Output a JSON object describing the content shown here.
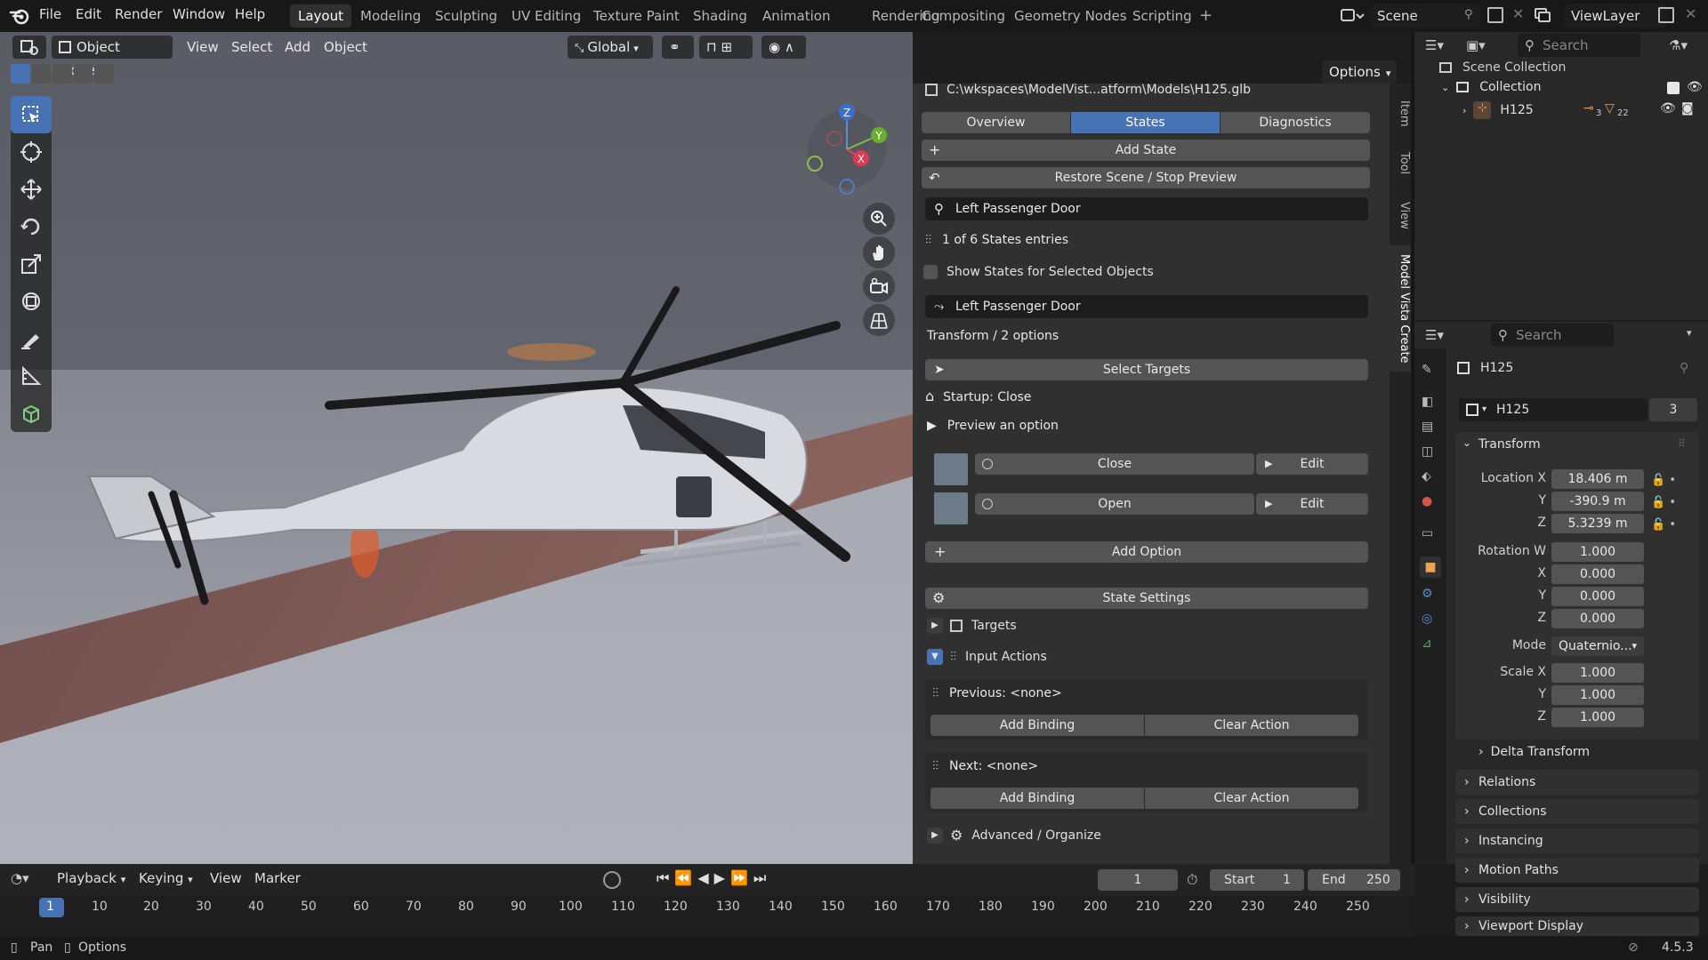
{
  "topbar": {
    "menus": [
      "File",
      "Edit",
      "Render",
      "Window",
      "Help"
    ],
    "workspaces": [
      "Layout",
      "Modeling",
      "Sculpting",
      "UV Editing",
      "Texture Paint",
      "Shading",
      "Animation",
      "Rendering",
      "Compositing",
      "Geometry Nodes",
      "Scripting"
    ],
    "active_workspace": "Layout",
    "scene": "Scene",
    "view_layer": "ViewLayer"
  },
  "viewport_header": {
    "mode": "Object Mode",
    "menus": [
      "View",
      "Select",
      "Add",
      "Object"
    ],
    "orientation": "Global",
    "options": "Options"
  },
  "gizmo": {
    "z": "Z",
    "y": "Y",
    "x": "X"
  },
  "npanel": {
    "file_path": "C:\\wkspaces\\ModelVist...atform\\Models\\H125.glb",
    "tabs": [
      "Overview",
      "States",
      "Diagnostics"
    ],
    "active_tab": "States",
    "add_state": "Add State",
    "restore": "Restore Scene / Stop Preview",
    "search_value": "Left Passenger Door",
    "entries": "1 of 6 States entries",
    "show_selected": "Show States for Selected Objects",
    "state_name": "Left Passenger Door",
    "transform_info": "Transform / 2 options",
    "select_targets": "Select Targets",
    "startup": "Startup: Close",
    "preview": "Preview an option",
    "options": [
      {
        "name": "Close",
        "edit": "Edit"
      },
      {
        "name": "Open",
        "edit": "Edit"
      }
    ],
    "add_option": "Add Option",
    "state_settings": "State Settings",
    "targets": "Targets",
    "input_actions": "Input Actions",
    "previous": "Previous: <none>",
    "next": "Next: <none>",
    "add_binding": "Add Binding",
    "clear_action": "Clear Action",
    "advanced": "Advanced / Organize",
    "side_tabs": [
      "Item",
      "Tool",
      "View",
      "Model Vista Create"
    ]
  },
  "outliner": {
    "search_placeholder": "Search",
    "scene_collection": "Scene Collection",
    "collection": "Collection",
    "object": "H125",
    "badge1": "3",
    "badge2": "22"
  },
  "properties": {
    "search_placeholder": "Search",
    "object_name": "H125",
    "datablock": "H125",
    "users": "3",
    "transform": "Transform",
    "location_label": "Location X",
    "location": [
      "18.406 m",
      "-390.9 m",
      "5.3239 m"
    ],
    "rotation_label": "Rotation W",
    "rotation": [
      "1.000",
      "0.000",
      "0.000",
      "0.000"
    ],
    "mode_label": "Mode",
    "mode": "Quaternio...",
    "scale_label": "Scale X",
    "scale": [
      "1.000",
      "1.000",
      "1.000"
    ],
    "axis": [
      "X",
      "Y",
      "Z"
    ],
    "delta": "Delta Transform",
    "sections": [
      "Relations",
      "Collections",
      "Instancing",
      "Motion Paths",
      "Visibility",
      "Viewport Display"
    ]
  },
  "timeline": {
    "menus": [
      "Playback",
      "Keying",
      "View",
      "Marker"
    ],
    "current_frame": "1",
    "start_label": "Start",
    "start": "1",
    "end_label": "End",
    "end": "250",
    "ruler": [
      "1",
      "10",
      "20",
      "30",
      "40",
      "50",
      "60",
      "70",
      "80",
      "90",
      "100",
      "110",
      "120",
      "130",
      "140",
      "150",
      "160",
      "170",
      "180",
      "190",
      "200",
      "210",
      "220",
      "230",
      "240",
      "250"
    ]
  },
  "statusbar": {
    "pan": "Pan",
    "options": "Options",
    "version": "4.5.3"
  },
  "colors": {
    "accent": "#4772b3",
    "panel": "#303030",
    "button": "#545454"
  }
}
